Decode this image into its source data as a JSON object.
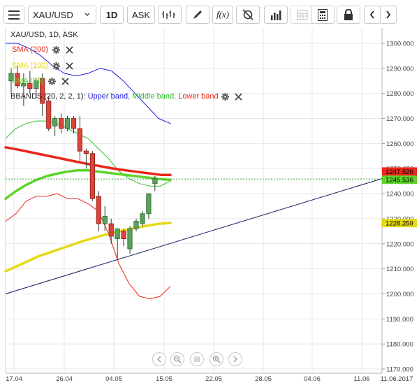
{
  "toolbar": {
    "symbol": "XAU/USD",
    "timeframe": "1D",
    "price_type": "ASK",
    "icons": [
      "menu-icon",
      "chart-type-icon",
      "draw-icon",
      "fx-icon",
      "settings-icon",
      "bar-chart-icon",
      "calendar-icon",
      "calculator-icon",
      "lock-icon",
      "prev-arrow-icon",
      "next-arrow-icon"
    ]
  },
  "chart_header": "XAU/USD, 1D, ASK",
  "indicators": [
    {
      "label": "SMA (200)",
      "color": "#e8281a"
    },
    {
      "label": "SMA (100)",
      "color": "#e6d817"
    },
    {
      "label": "SMA (55)",
      "color": "#5fd32b"
    }
  ],
  "bbands": {
    "label": "BBANDS (20, 2, 2, 1):",
    "upper": "Upper band,",
    "middle": "Middle band,",
    "lower": "Lower band",
    "upper_color": "#1f1fe0",
    "middle_color": "#2bbf2b",
    "lower_color": "#e8281a"
  },
  "price_tags": {
    "sma200": "1247.526",
    "sma200_color": "#e8281a",
    "sma55": "1245.536",
    "sma55_color": "#5fd32b",
    "sma100": "1228.259",
    "sma100_color": "#e6d817"
  },
  "chart_data": {
    "type": "candlestick",
    "y_ticks": [
      "1300.000",
      "1290.000",
      "1280.000",
      "1270.000",
      "1260.000",
      "1250.000",
      "1240.000",
      "1230.000",
      "1220.000",
      "1210.000",
      "1200.000",
      "1190.000",
      "1180.000",
      "1170.000"
    ],
    "x_ticks": [
      "17.04",
      "26.04",
      "04.05",
      "15.05",
      "22.05",
      "28.05",
      "04.06",
      "11.06",
      "11.06.2017"
    ],
    "ylim": [
      1170,
      1300
    ],
    "candles": [
      {
        "o": 1285,
        "h": 1290,
        "l": 1280,
        "c": 1288
      },
      {
        "o": 1288,
        "h": 1291,
        "l": 1282,
        "c": 1283
      },
      {
        "o": 1283,
        "h": 1288,
        "l": 1275,
        "c": 1284
      },
      {
        "o": 1284,
        "h": 1289,
        "l": 1280,
        "c": 1282
      },
      {
        "o": 1282,
        "h": 1286,
        "l": 1278,
        "c": 1285
      },
      {
        "o": 1286,
        "h": 1288,
        "l": 1271,
        "c": 1276
      },
      {
        "o": 1277,
        "h": 1279,
        "l": 1265,
        "c": 1266
      },
      {
        "o": 1267,
        "h": 1271,
        "l": 1263,
        "c": 1270
      },
      {
        "o": 1270,
        "h": 1272,
        "l": 1264,
        "c": 1266
      },
      {
        "o": 1266,
        "h": 1271,
        "l": 1265,
        "c": 1270
      },
      {
        "o": 1270,
        "h": 1271,
        "l": 1264,
        "c": 1266
      },
      {
        "o": 1266,
        "h": 1271,
        "l": 1253,
        "c": 1257
      },
      {
        "o": 1257,
        "h": 1258,
        "l": 1250,
        "c": 1256
      },
      {
        "o": 1256,
        "h": 1257,
        "l": 1237,
        "c": 1238
      },
      {
        "o": 1239,
        "h": 1241,
        "l": 1225,
        "c": 1228
      },
      {
        "o": 1228,
        "h": 1235,
        "l": 1225,
        "c": 1231
      },
      {
        "o": 1228,
        "h": 1230,
        "l": 1220,
        "c": 1223
      },
      {
        "o": 1222,
        "h": 1226,
        "l": 1214,
        "c": 1226
      },
      {
        "o": 1225,
        "h": 1226,
        "l": 1219,
        "c": 1222
      },
      {
        "o": 1218,
        "h": 1227,
        "l": 1216,
        "c": 1226
      },
      {
        "o": 1226,
        "h": 1230,
        "l": 1225,
        "c": 1229
      },
      {
        "o": 1228,
        "h": 1233,
        "l": 1227,
        "c": 1232
      },
      {
        "o": 1232,
        "h": 1240,
        "l": 1230,
        "c": 1240
      },
      {
        "o": 1244,
        "h": 1247,
        "l": 1241,
        "c": 1246
      }
    ],
    "sma200": [
      1258.5,
      1257.8,
      1257.0,
      1256.2,
      1255.4,
      1254.6,
      1253.8,
      1253.0,
      1252.2,
      1251.5,
      1250.8,
      1250.1,
      1249.5,
      1249.0,
      1248.5,
      1248.0,
      1247.5,
      1247.5
    ],
    "sma100": [
      1209,
      1211,
      1213,
      1215,
      1216.5,
      1218,
      1219.5,
      1221,
      1222.3,
      1223.5,
      1224.6,
      1225.6,
      1226.5,
      1227.3,
      1228.0,
      1228.3
    ],
    "sma55": [
      1238,
      1241,
      1243.5,
      1245.5,
      1247,
      1248,
      1248.8,
      1249.3,
      1249.3,
      1248.8,
      1248.3,
      1247.8,
      1247.3,
      1246.8,
      1246.3,
      1245.8,
      1245.5
    ],
    "bb_upper": [
      1300,
      1300,
      1298,
      1295,
      1291,
      1288,
      1287,
      1288,
      1290,
      1289,
      1285,
      1280,
      1275,
      1270,
      1268
    ],
    "bb_middle": [
      1262,
      1266,
      1268,
      1269,
      1269,
      1268,
      1266,
      1264,
      1262,
      1258,
      1254,
      1249,
      1246,
      1244,
      1243,
      1243,
      1245
    ],
    "bb_lower": [
      1229,
      1232,
      1237,
      1239,
      1239,
      1240,
      1238,
      1238,
      1236,
      1233,
      1224,
      1212,
      1204,
      1199,
      1198,
      1199,
      1203
    ],
    "trend_support": {
      "from": [
        0,
        1200
      ],
      "to": [
        1,
        1246
      ]
    }
  },
  "nav": [
    "first-page-icon",
    "zoom-out-icon",
    "scroll-handle-icon",
    "zoom-in-icon",
    "last-page-icon"
  ]
}
